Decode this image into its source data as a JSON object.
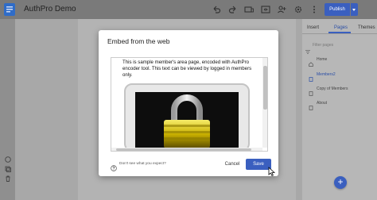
{
  "app": {
    "title": "AuthPro Demo"
  },
  "toolbar": {
    "icons": [
      "undo-icon",
      "redo-icon",
      "device-preview-icon",
      "preview-icon",
      "share-icon",
      "settings-icon",
      "more-icon"
    ],
    "publish_label": "Publish"
  },
  "right_panel": {
    "tabs": [
      {
        "label": "Insert",
        "active": false
      },
      {
        "label": "Pages",
        "active": true
      },
      {
        "label": "Themes",
        "active": false
      }
    ],
    "filter_placeholder": "Filter pages",
    "pages": [
      {
        "label": "Home",
        "icon": "home-icon",
        "selected": false
      },
      {
        "label": "Members2",
        "icon": "page-icon",
        "selected": true
      },
      {
        "label": "Copy of Members",
        "icon": "page-icon",
        "selected": false
      },
      {
        "label": "About",
        "icon": "page-icon",
        "selected": false
      }
    ],
    "fab_label": "+"
  },
  "dialog": {
    "title": "Embed from the web",
    "preview_text": "This is sample member's area page, encoded with AuthPro encoder tool. This text can be viewed by logged in members only.",
    "help_text": "Don't see what you expect?",
    "cancel_label": "Cancel",
    "save_label": "Save"
  },
  "colors": {
    "accent": "#3a5fbf",
    "overlay": "#7a7a7a"
  }
}
